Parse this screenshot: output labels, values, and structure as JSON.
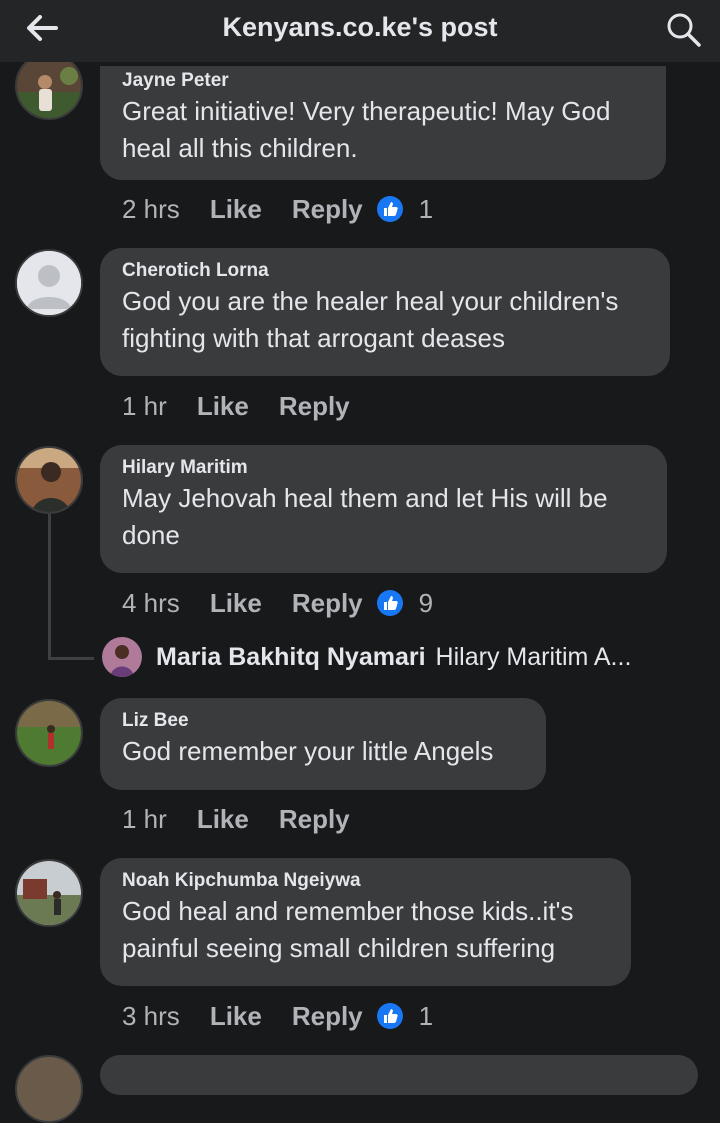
{
  "header": {
    "title": "Kenyans.co.ke's post"
  },
  "comments": [
    {
      "author": "Jayne Peter",
      "text": "Great initiative! Very therapeutic! May God heal all this children.",
      "time": "2 hrs",
      "like": "Like",
      "reply": "Reply",
      "reactions": "1"
    },
    {
      "author": "Cherotich Lorna",
      "text": "God you are the healer heal your children's fighting with that arrogant deases",
      "time": "1 hr",
      "like": "Like",
      "reply": "Reply"
    },
    {
      "author": "Hilary Maritim",
      "text": "May Jehovah heal them and let His will be done",
      "time": "4 hrs",
      "like": "Like",
      "reply": "Reply",
      "reactions": "9",
      "reply_preview": {
        "author": "Maria Bakhitq Nyamari",
        "text": "Hilary Maritim A..."
      }
    },
    {
      "author": "Liz Bee",
      "text": "God remember your little Angels",
      "time": "1 hr",
      "like": "Like",
      "reply": "Reply"
    },
    {
      "author": "Noah Kipchumba Ngeiywa",
      "text": "God heal and remember those kids..it's painful seeing small children suffering",
      "time": "3 hrs",
      "like": "Like",
      "reply": "Reply",
      "reactions": "1"
    }
  ],
  "colors": {
    "background": "#18191a",
    "bubble": "#3a3b3c",
    "like_blue": "#1877f2",
    "secondary_text": "#b0b3b8"
  },
  "icons": {
    "back": "arrow-left-icon",
    "search": "search-icon",
    "reaction": "thumbs-up-icon"
  }
}
